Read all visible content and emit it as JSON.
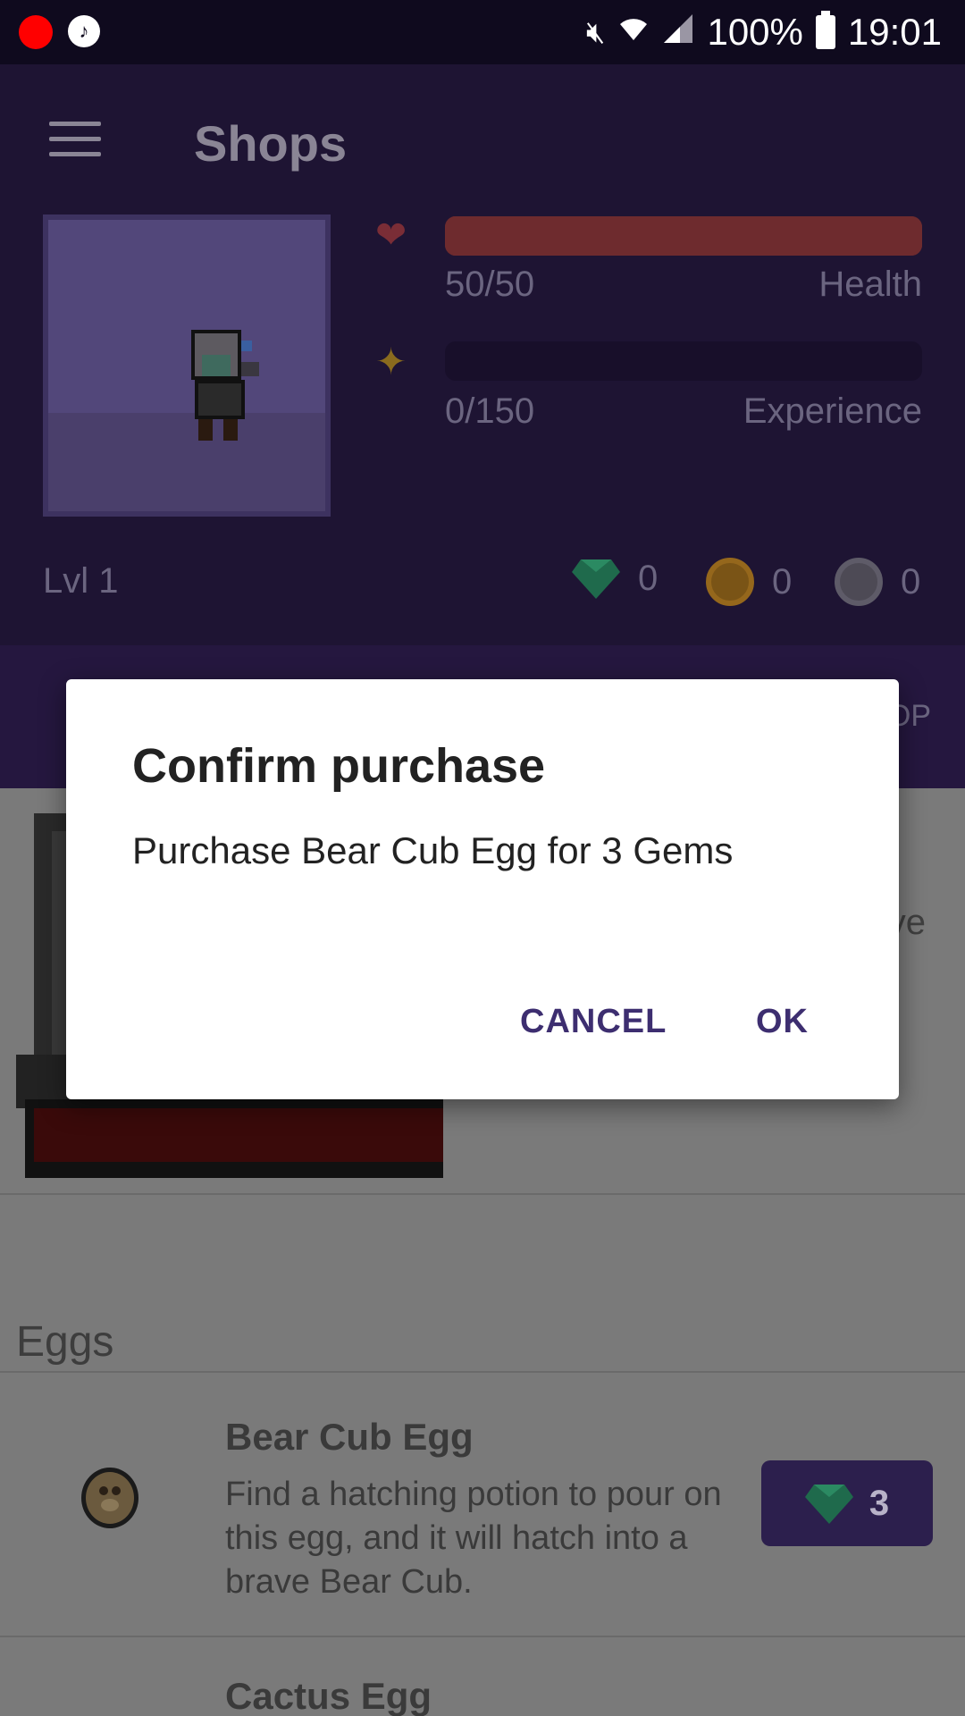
{
  "status_bar": {
    "battery": "100%",
    "time": "19:01",
    "icons": [
      "record-icon",
      "music-icon",
      "mute-icon",
      "wifi-icon",
      "signal-icon",
      "battery-icon"
    ]
  },
  "header": {
    "title": "Shops",
    "health": {
      "value": "50/50",
      "label": "Health",
      "fraction": 1.0,
      "color": "#6e2b2e"
    },
    "experience": {
      "value": "0/150",
      "label": "Experience",
      "fraction": 0.0
    },
    "level": "Lvl 1",
    "currencies": [
      {
        "icon": "gem-icon",
        "amount": "0"
      },
      {
        "icon": "gold-coin-icon",
        "amount": "0"
      },
      {
        "icon": "silver-coin-icon",
        "amount": "0"
      }
    ],
    "tab_fragment": "OP"
  },
  "featured": {
    "text_fragment": "ve"
  },
  "eggs_section": {
    "title": "Eggs",
    "items": [
      {
        "name": "Bear Cub Egg",
        "description": "Find a hatching potion to pour on this egg, and it will hatch into a brave Bear Cub.",
        "price": "3"
      },
      {
        "name": "Cactus Egg"
      }
    ]
  },
  "dialog": {
    "title": "Confirm purchase",
    "message": "Purchase Bear Cub Egg for 3 Gems",
    "cancel_label": "CANCEL",
    "ok_label": "OK"
  }
}
